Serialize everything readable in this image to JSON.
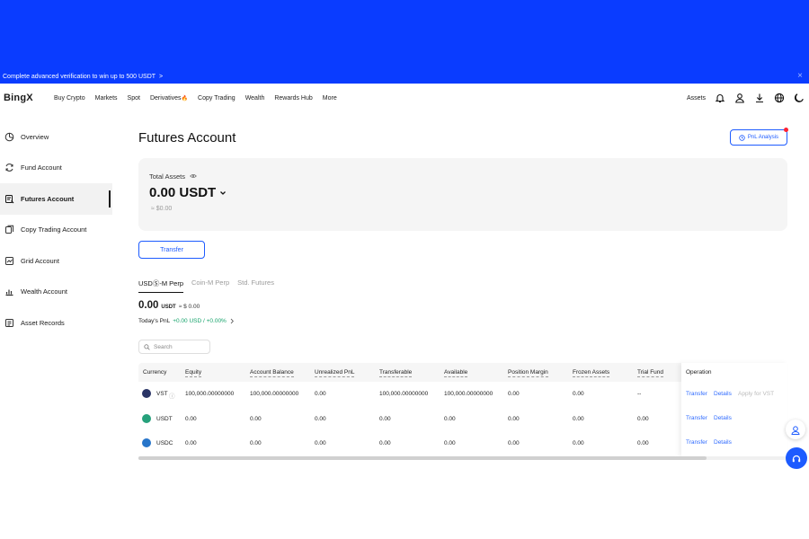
{
  "banner": {
    "text": "Complete advanced verification to win up to 500 USDT",
    "arrow": ">",
    "close": "×"
  },
  "nav": {
    "logo": "BingX",
    "links": [
      "Buy Crypto",
      "Markets",
      "Spot",
      "Derivatives",
      "Copy Trading",
      "Wealth",
      "Rewards Hub",
      "More"
    ],
    "derivatives_badge": "🔥",
    "assets": "Assets",
    "icons": [
      "bell-icon",
      "user-icon",
      "download-icon",
      "globe-icon",
      "moon-icon"
    ]
  },
  "sidebar": {
    "items": [
      {
        "label": "Overview",
        "icon": "pie-icon",
        "active": false
      },
      {
        "label": "Fund Account",
        "icon": "refresh-icon",
        "active": false
      },
      {
        "label": "Futures Account",
        "icon": "futures-icon",
        "active": true
      },
      {
        "label": "Copy Trading Account",
        "icon": "copy-icon",
        "active": false
      },
      {
        "label": "Grid Account",
        "icon": "grid-icon",
        "active": false
      },
      {
        "label": "Wealth Account",
        "icon": "chart-icon",
        "active": false
      },
      {
        "label": "Asset Records",
        "icon": "records-icon",
        "active": false
      }
    ]
  },
  "main": {
    "title": "Futures Account",
    "pnl_button": "PnL Analysis",
    "total_label": "Total Assets",
    "total_value": "0.00",
    "total_unit": "USDT",
    "total_fiat": "≈ $0.00",
    "transfer_button": "Transfer",
    "tabs": [
      "USDⓈ-M Perp",
      "Coin-M Perp",
      "Std. Futures"
    ],
    "balance": "0.00",
    "balance_unit": "USDT",
    "balance_fiat": "≈ $ 0.00",
    "todays_pnl_label": "Today's PnL",
    "todays_pnl_value": "+0.00 USD / +0.00%",
    "search_placeholder": "Search"
  },
  "table": {
    "headers": [
      "Currency",
      "Equity",
      "Account Balance",
      "Unrealized PnL",
      "Transferable",
      "Available",
      "Position Margin",
      "Frozen Assets",
      "Trial Fund",
      "Operation"
    ],
    "rows": [
      {
        "currency": "VST",
        "equity": "100,000.00000000",
        "account_balance": "100,000.00000000",
        "unrealized_pnl": "0.00",
        "transferable": "100,000.00000000",
        "available": "100,000.00000000",
        "position_margin": "0.00",
        "frozen_assets": "0.00",
        "trial_fund": "--",
        "ops": [
          "Transfer",
          "Details",
          "Apply for VST"
        ],
        "coin_color": "#2a3566"
      },
      {
        "currency": "USDT",
        "equity": "0.00",
        "account_balance": "0.00",
        "unrealized_pnl": "0.00",
        "transferable": "0.00",
        "available": "0.00",
        "position_margin": "0.00",
        "frozen_assets": "0.00",
        "trial_fund": "0.00",
        "ops": [
          "Transfer",
          "Details",
          ""
        ],
        "coin_color": "#26a17b"
      },
      {
        "currency": "USDC",
        "equity": "0.00",
        "account_balance": "0.00",
        "unrealized_pnl": "0.00",
        "transferable": "0.00",
        "available": "0.00",
        "position_margin": "0.00",
        "frozen_assets": "0.00",
        "trial_fund": "0.00",
        "ops": [
          "Transfer",
          "Details",
          ""
        ],
        "coin_color": "#2775ca"
      }
    ]
  },
  "colors": {
    "brand_blue": "#0a3cff",
    "link_blue": "#2f6bff",
    "green": "#16a36b"
  }
}
